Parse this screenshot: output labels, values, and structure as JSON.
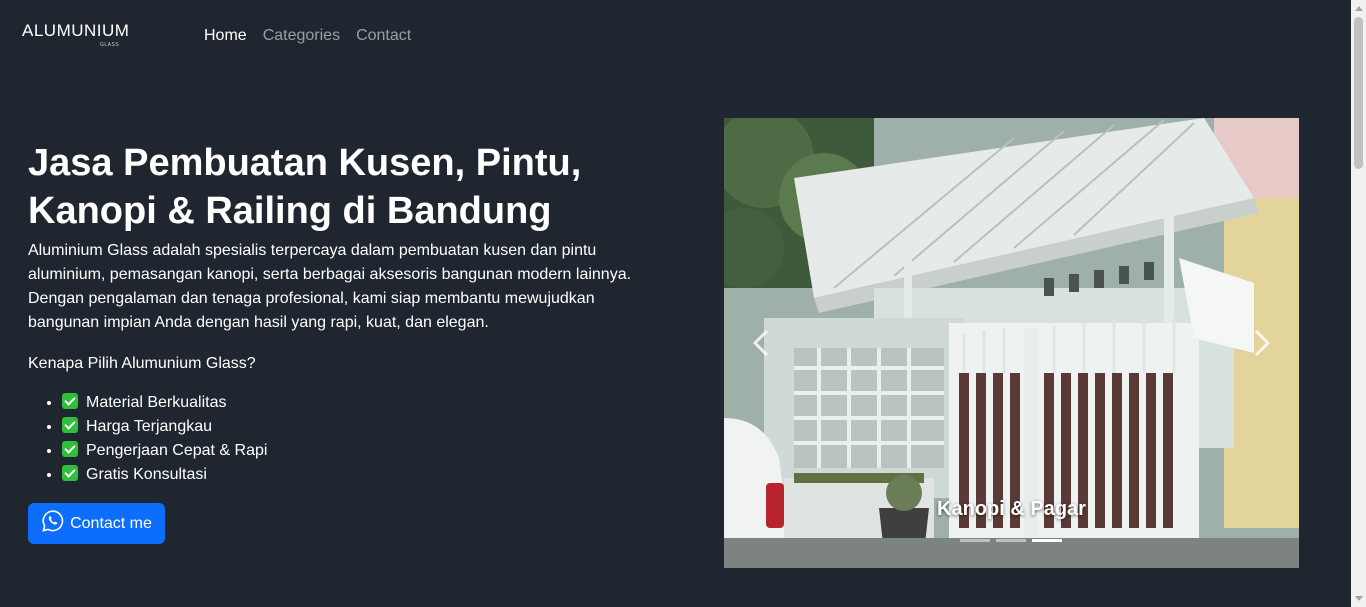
{
  "brand": {
    "name": "ALUMUNIUM",
    "sub": "GLASS"
  },
  "nav": [
    {
      "label": "Home",
      "active": true
    },
    {
      "label": "Categories",
      "active": false
    },
    {
      "label": "Contact",
      "active": false
    }
  ],
  "hero": {
    "title": "Jasa Pembuatan Kusen, Pintu, Kanopi & Railing di Bandung",
    "description": "Aluminium Glass adalah spesialis terpercaya dalam pembuatan kusen dan pintu aluminium, pemasangan kanopi, serta berbagai aksesoris bangunan modern lainnya. Dengan pengalaman dan tenaga profesional, kami siap membantu mewujudkan bangunan impian Anda dengan hasil yang rapi, kuat, dan elegan.",
    "why_title": "Kenapa Pilih Alumunium Glass?",
    "features": [
      "Material Berkualitas",
      "Harga Terjangkau",
      "Pengerjaan Cepat & Rapi",
      "Gratis Konsultasi"
    ],
    "contact_label": "Contact me"
  },
  "carousel": {
    "caption": "Kanopi & Pagar",
    "slide_count": 3,
    "active_slide": 3
  },
  "colors": {
    "background": "#1f262f",
    "primary": "#0d6efd",
    "check": "#2fbf3c"
  },
  "icons": {
    "contact": "whatsapp-icon",
    "feature": "check-mark-icon",
    "prev": "chevron-left-icon",
    "next": "chevron-right-icon"
  }
}
